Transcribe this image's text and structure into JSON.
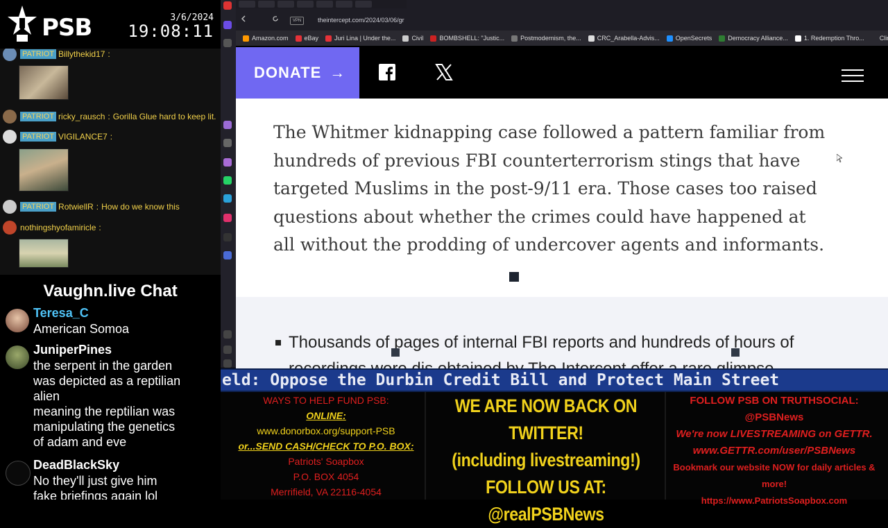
{
  "overlay": {
    "brand": "PSB",
    "date": "3/6/2024",
    "time": "19:08:11"
  },
  "chat_top": {
    "messages": [
      {
        "badge": "PATRIOT",
        "user": "Billythekid17",
        "text": ":"
      },
      {
        "badge": "PATRIOT",
        "user": "ricky_rausch",
        "text": ":",
        "body": "Gorilla Glue hard to keep lit."
      },
      {
        "badge": "PATRIOT",
        "user": "VIGILANCE7",
        "text": ":"
      },
      {
        "badge": "PATRIOT",
        "user": "RotwiellR",
        "text": ":",
        "body": "How do we know this"
      },
      {
        "badge": "",
        "user": "nothingshyofamiricle",
        "text": ":"
      }
    ]
  },
  "vaughn": {
    "title": "Vaughn.live Chat",
    "messages": [
      {
        "user": "Teresa_C",
        "color": "#4fc3f7",
        "lines": [
          "American Somoa"
        ]
      },
      {
        "user": "JuniperPines",
        "color": "#ffffff",
        "lines": [
          "the serpent in the garden",
          "was depicted as a reptilian",
          "alien",
          "meaning the reptilian was",
          "manipulating the genetics",
          "of adam and eve"
        ]
      },
      {
        "user": "DeadBlackSky",
        "color": "#ffffff",
        "lines": [
          "No they'll just give him",
          "fake briefings again lol"
        ]
      }
    ]
  },
  "browser": {
    "url": "theintercept.com/2024/03/06/gr",
    "vpn": "VPN",
    "bookmarks": [
      {
        "label": "Amazon.com",
        "color": "#ff9900"
      },
      {
        "label": "eBay",
        "color": "#e53238"
      },
      {
        "label": "Juri Lina | Under the...",
        "color": "#e53238"
      },
      {
        "label": "Civil",
        "color": "#cccccc"
      },
      {
        "label": "BOMBSHELL: \"Justic...",
        "color": "#cc2222"
      },
      {
        "label": "Postmodernism, the...",
        "color": "#777777"
      },
      {
        "label": "CRC_Arabella-Advis...",
        "color": "#dddddd"
      },
      {
        "label": "OpenSecrets",
        "color": "#1e90ff"
      },
      {
        "label": "Democracy Alliance...",
        "color": "#2e7d32"
      },
      {
        "label": "1. Redemption Thro...",
        "color": "#ffffff"
      },
      {
        "label": "Clinton Email: We M...",
        "color": "#cccccc"
      }
    ]
  },
  "site": {
    "donate_label": "DONATE",
    "donate_arrow": "→",
    "paragraph": "The Whitmer kidnapping case followed a pattern familiar from hundreds of previous FBI counterterrorism stings that have targeted Muslims in the post-9/11 era. Those cases too raised questions about whether the crimes could have happened at all without the prodding of undercover agents and informants.",
    "bullet_text": "Thousands of pages of internal FBI reports and hundreds of hours of",
    "bullet_text_cont": "recordings were dis obtained by The Intercept offer a rare glimpse"
  },
  "ticker": {
    "text": "eld: Oppose the Durbin Credit Bill and Protect Main Street"
  },
  "bottom": {
    "left": {
      "heading": "WAYS TO HELP FUND PSB:",
      "online": "ONLINE:",
      "url": "www.donorbox.org/support-PSB",
      "or_send": "or...SEND CASH/CHECK TO P.O. BOX:",
      "addr1": "Patriots' Soapbox",
      "addr2": "P.O. BOX 4054",
      "addr3": "Merrifield, VA 22116-4054"
    },
    "middle": {
      "line1": "WE ARE NOW BACK ON TWITTER!",
      "line2": "(including livestreaming!)",
      "line3": "FOLLOW US AT:",
      "line4": "@realPSBNews"
    },
    "right": {
      "line1": "FOLLOW PSB ON TRUTHSOCIAL:",
      "line2": "@PSBNews",
      "line3": "We're now LIVESTREAMING on GETTR.",
      "line4": "www.GETTR.com/user/PSBNews",
      "line5": "Bookmark our website NOW for daily articles & more!",
      "line6": "https://www.PatriotsSoapbox.com"
    }
  }
}
